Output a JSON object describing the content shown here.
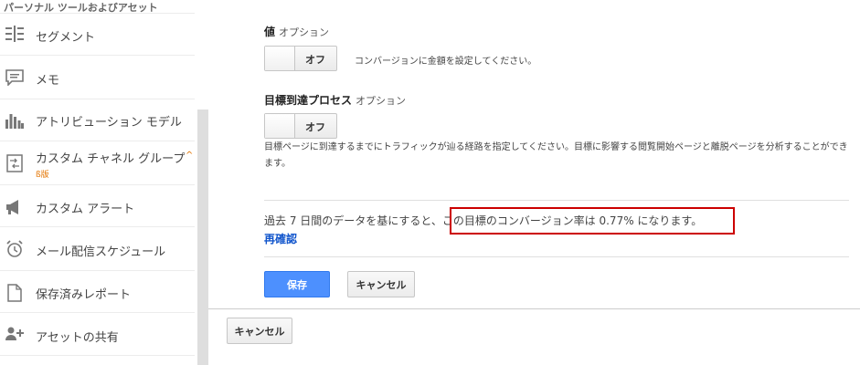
{
  "sidebar": {
    "section_title": "パーソナル ツールおよびアセット",
    "items": [
      {
        "label": "セグメント",
        "icon": "segment-icon"
      },
      {
        "label": "メモ",
        "icon": "memo-icon"
      },
      {
        "label": "アトリビューション モデル",
        "icon": "bar-chart-icon"
      },
      {
        "label": "カスタム チャネル グループ",
        "sublabel": "ß版",
        "chevron": "^",
        "icon": "channel-icon"
      },
      {
        "label": "カスタム アラート",
        "icon": "megaphone-icon"
      },
      {
        "label": "メール配信スケジュール",
        "icon": "alarm-clock-icon"
      },
      {
        "label": "保存済みレポート",
        "icon": "document-icon"
      },
      {
        "label": "アセットの共有",
        "icon": "add-person-icon"
      }
    ]
  },
  "value_field": {
    "title": "値",
    "optional": "オプション",
    "toggle_state": "オフ",
    "hint": "コンバージョンに金額を設定してください。"
  },
  "funnel_field": {
    "title": "目標到達プロセス",
    "optional": "オプション",
    "toggle_state": "オフ",
    "description": "目標ページに到達するまでにトラフィックが辿る経路を指定してください。目標に影響する閲覧開始ページと離脱ページを分析することができます。"
  },
  "estimate": {
    "prefix": "過去 7 日間のデータを基にすると、",
    "highlighted": "この目標のコンバージョン率は 0.77% になります。",
    "recheck_link": "再確認"
  },
  "actions": {
    "save_label": "保存",
    "cancel_label": "キャンセル",
    "outer_cancel_label": "キャンセル"
  },
  "colors": {
    "primary_button": "#4d90fe",
    "highlight_border": "#cc0000",
    "link": "#1155cc",
    "beta_accent": "#e37400"
  }
}
